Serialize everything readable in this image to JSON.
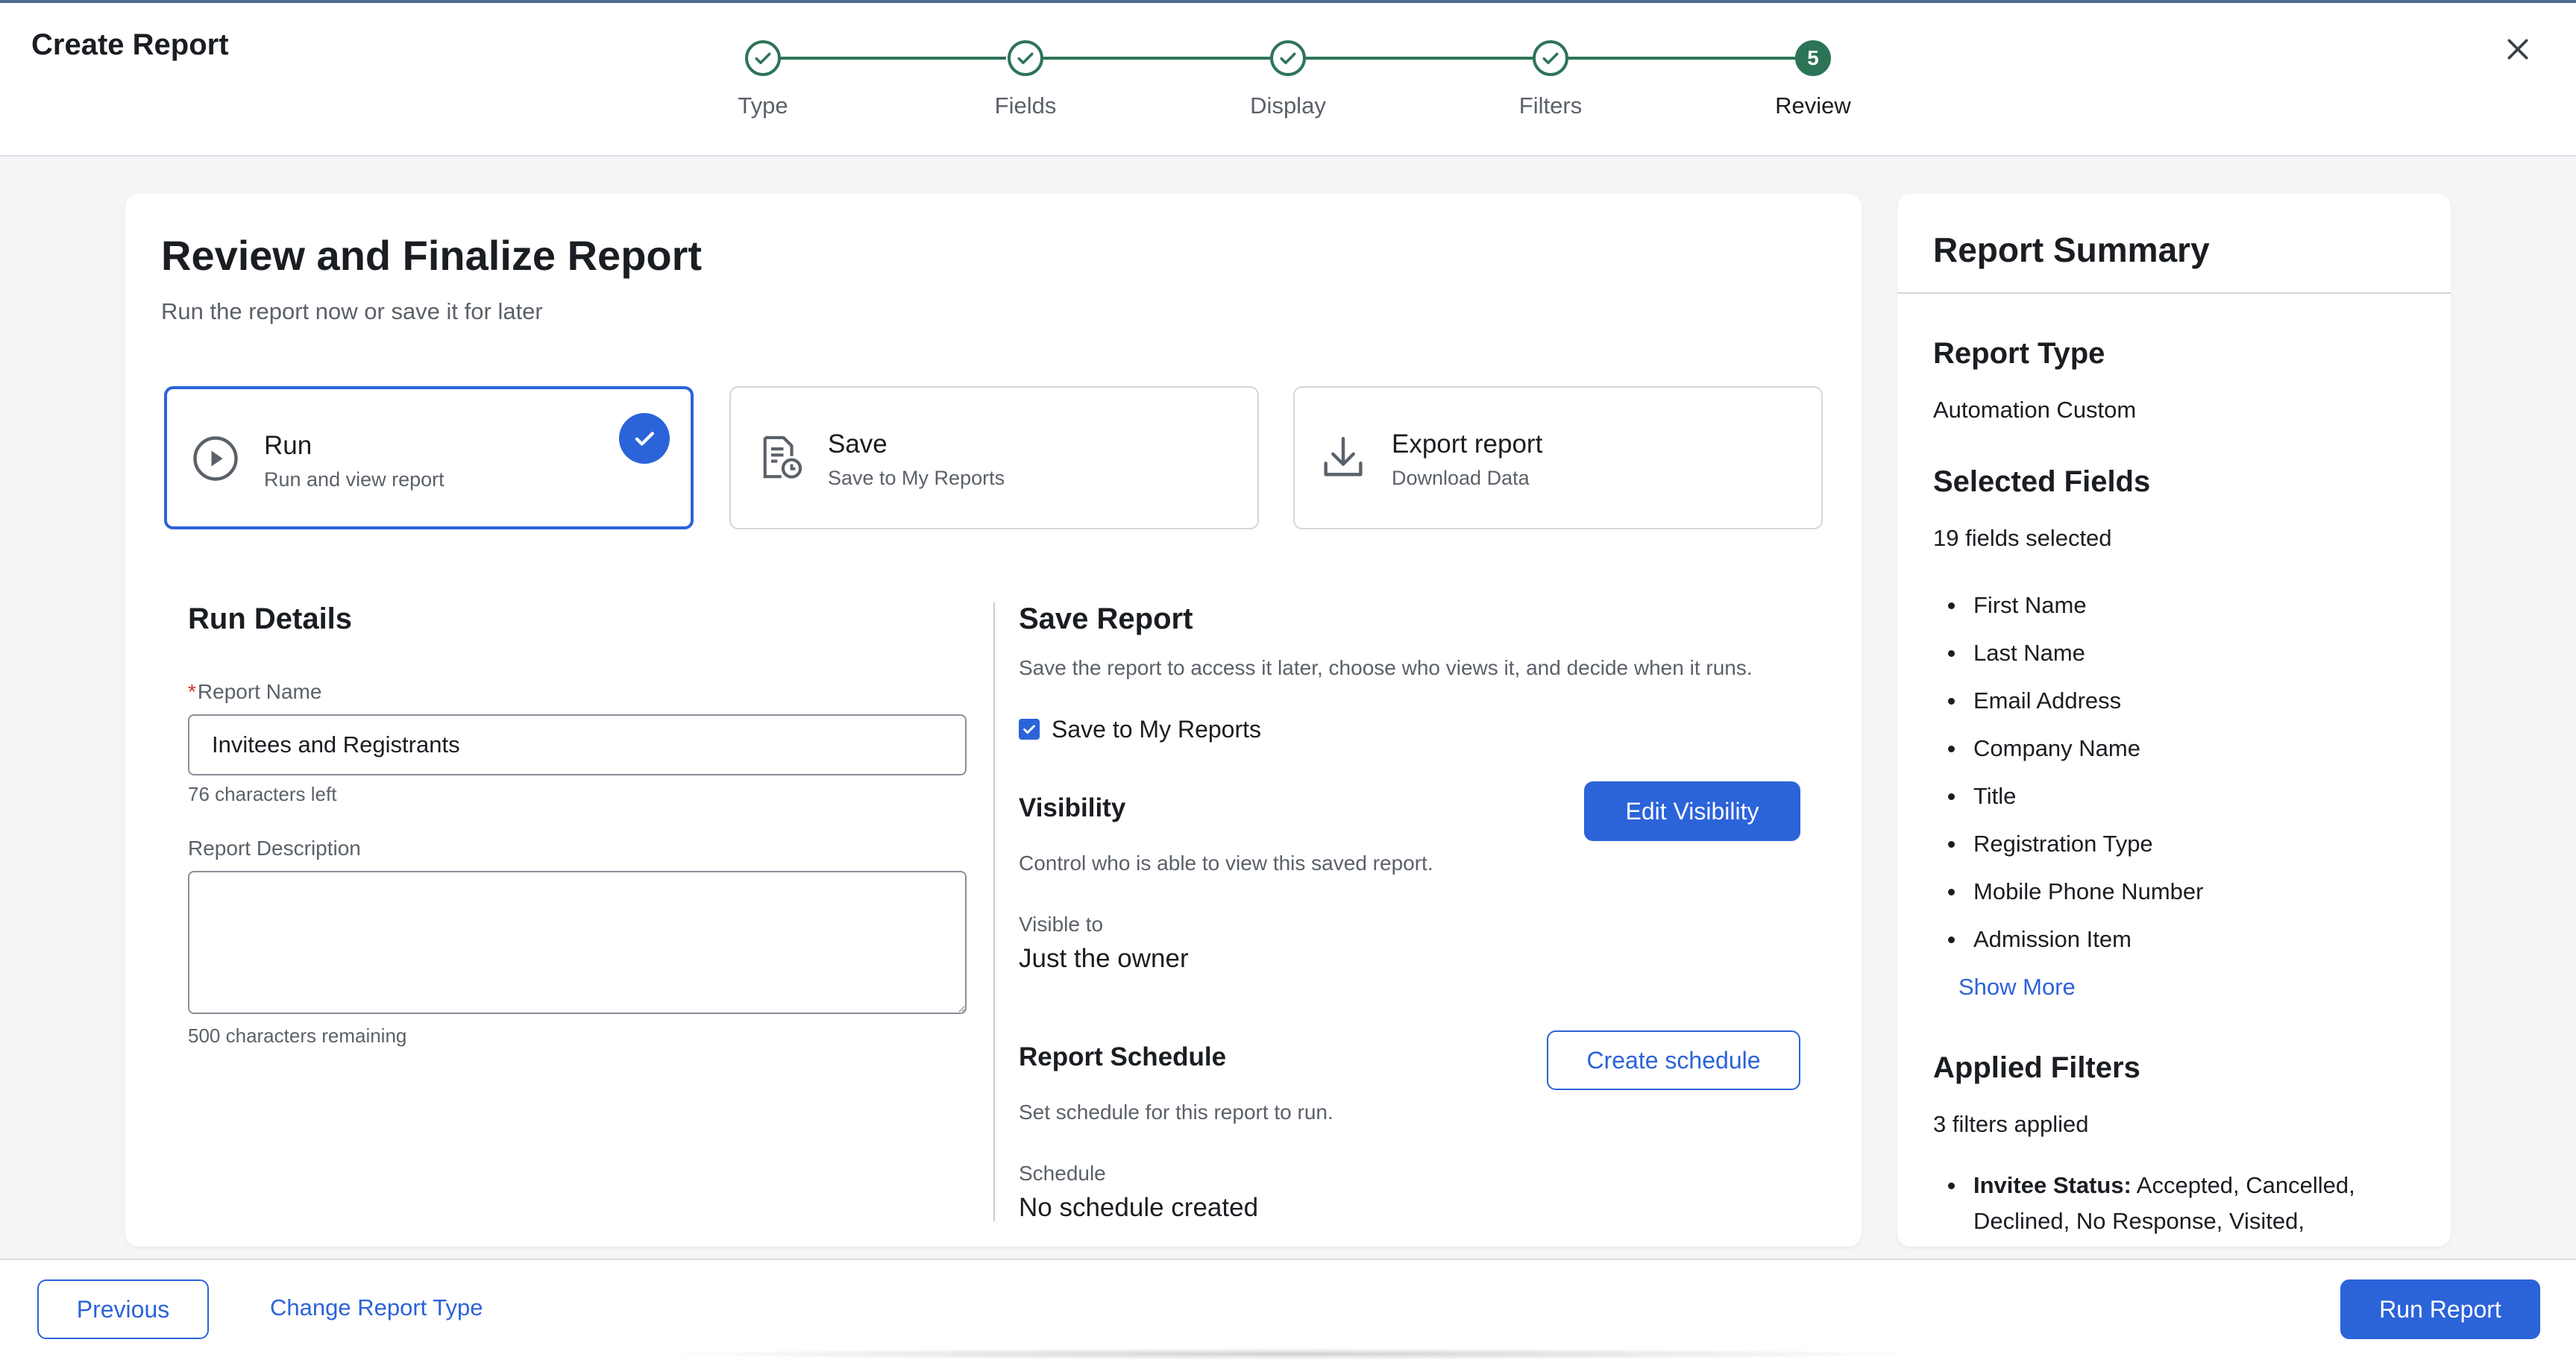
{
  "header": {
    "title": "Create Report",
    "steps": [
      {
        "label": "Type",
        "state": "complete"
      },
      {
        "label": "Fields",
        "state": "complete"
      },
      {
        "label": "Display",
        "state": "complete"
      },
      {
        "label": "Filters",
        "state": "complete"
      },
      {
        "label": "Review",
        "state": "current",
        "number": "5"
      }
    ]
  },
  "main": {
    "title": "Review and Finalize Report",
    "subtitle": "Run the report now or save it for later",
    "options": [
      {
        "title": "Run",
        "subtitle": "Run and view report",
        "icon": "play-circle-icon",
        "selected": true
      },
      {
        "title": "Save",
        "subtitle": "Save to My Reports",
        "icon": "document-clock-icon",
        "selected": false
      },
      {
        "title": "Export report",
        "subtitle": "Download Data",
        "icon": "download-icon",
        "selected": false
      }
    ],
    "run_details": {
      "title": "Run Details",
      "name_label": "Report Name",
      "name_value": "Invitees and Registrants",
      "name_help": "76 characters left",
      "description_label": "Report Description",
      "description_value": "",
      "description_help": "500 characters remaining"
    },
    "save_report": {
      "title": "Save Report",
      "description": "Save the report to access it later, choose who views it, and decide when it runs.",
      "checkbox_label": "Save to My Reports",
      "checkbox_checked": true,
      "visibility_title": "Visibility",
      "visibility_button": "Edit Visibility",
      "visibility_description": "Control who is able to view this saved report.",
      "visible_to_label": "Visible to",
      "visible_to_value": "Just the owner",
      "schedule_title": "Report Schedule",
      "schedule_button": "Create schedule",
      "schedule_description": "Set schedule for this report to run.",
      "schedule_label": "Schedule",
      "schedule_value": "No schedule created"
    }
  },
  "summary": {
    "title": "Report Summary",
    "report_type_title": "Report Type",
    "report_type_value": "Automation Custom",
    "fields_title": "Selected Fields",
    "fields_count": "19 fields selected",
    "fields": [
      "First Name",
      "Last Name",
      "Email Address",
      "Company Name",
      "Title",
      "Registration Type",
      "Mobile Phone Number",
      "Admission Item"
    ],
    "show_more": "Show More",
    "filters_title": "Applied Filters",
    "filters_count": "3 filters applied",
    "filter_first_label": "Invitee Status:",
    "filter_first_values": "Accepted, Cancelled, Declined, No Response, Visited,"
  },
  "footer": {
    "previous": "Previous",
    "change_type": "Change Report Type",
    "run_report": "Run Report"
  },
  "colors": {
    "accent": "#2b63d9",
    "step_green": "#2d7457",
    "required": "#d2302c"
  }
}
